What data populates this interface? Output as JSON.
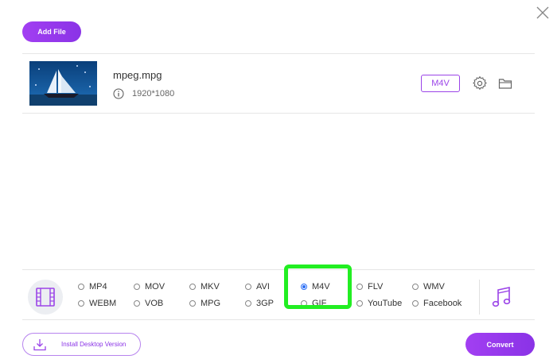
{
  "header": {
    "add_file_label": "Add File"
  },
  "file": {
    "name": "mpeg.mpg",
    "resolution": "1920*1080",
    "target_format": "M4V"
  },
  "formats": [
    {
      "label": "MP4",
      "selected": false
    },
    {
      "label": "MOV",
      "selected": false
    },
    {
      "label": "MKV",
      "selected": false
    },
    {
      "label": "AVI",
      "selected": false
    },
    {
      "label": "M4V",
      "selected": true
    },
    {
      "label": "FLV",
      "selected": false
    },
    {
      "label": "WMV",
      "selected": false
    },
    {
      "label": "WEBM",
      "selected": false
    },
    {
      "label": "VOB",
      "selected": false
    },
    {
      "label": "MPG",
      "selected": false
    },
    {
      "label": "3GP",
      "selected": false
    },
    {
      "label": "GIF",
      "selected": false
    },
    {
      "label": "YouTube",
      "selected": false
    },
    {
      "label": "Facebook",
      "selected": false
    }
  ],
  "footer": {
    "install_label": "Install Desktop Version",
    "convert_label": "Convert"
  },
  "colors": {
    "accent": "#9b44e8",
    "highlight": "#22ee22",
    "radio_selected": "#2a6df5"
  },
  "icons": [
    "close-icon",
    "info-icon",
    "settings-icon",
    "folder-icon",
    "video-format-icon",
    "audio-format-icon",
    "download-icon"
  ]
}
